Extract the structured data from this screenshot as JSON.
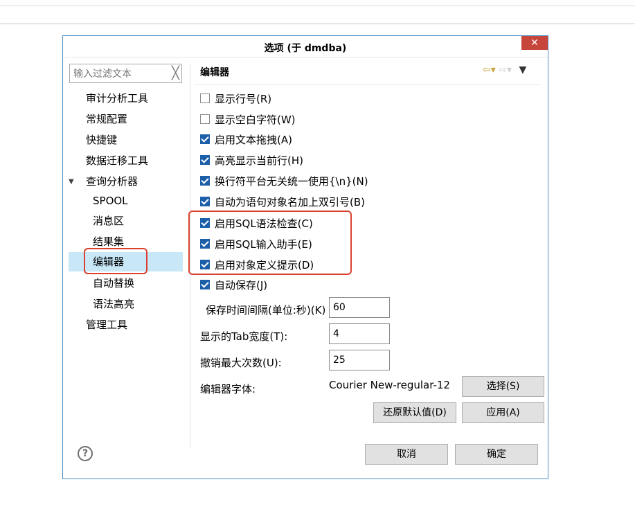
{
  "dialog": {
    "title": "选项   (于 dmdba)",
    "close_icon": "close-icon",
    "close_glyph": "✕"
  },
  "filter": {
    "placeholder": "输入过滤文本",
    "clear_glyph": "╳"
  },
  "tree": {
    "items": [
      {
        "label": "审计分析工具"
      },
      {
        "label": "常规配置"
      },
      {
        "label": "快捷键"
      },
      {
        "label": "数据迁移工具"
      },
      {
        "label": "查询分析器",
        "expanded": true,
        "arrow": "▼"
      },
      {
        "label": "SPOOL"
      },
      {
        "label": "消息区"
      },
      {
        "label": "结果集"
      },
      {
        "label": "编辑器",
        "selected": true
      },
      {
        "label": "自动替换"
      },
      {
        "label": "语法高亮"
      },
      {
        "label": "管理工具"
      }
    ]
  },
  "panel": {
    "title": "编辑器",
    "nav_back": "⇦▾",
    "nav_forward": "⇨▾",
    "nav_menu": "▼",
    "checkboxes": [
      {
        "label": "显示行号(R)",
        "checked": false
      },
      {
        "label": "显示空白字符(W)",
        "checked": false
      },
      {
        "label": "启用文本拖拽(A)",
        "checked": true
      },
      {
        "label": "高亮显示当前行(H)",
        "checked": true
      },
      {
        "label": "换行符平台无关统一使用{\\n}(N)",
        "checked": true
      },
      {
        "label": "自动为语句对象名加上双引号(B)",
        "checked": true
      },
      {
        "label": "启用SQL语法检查(C)",
        "checked": true
      },
      {
        "label": "启用SQL输入助手(E)",
        "checked": true
      },
      {
        "label": "启用对象定义提示(D)",
        "checked": true
      },
      {
        "label": "自动保存(J)",
        "checked": true
      }
    ],
    "autosave_interval_label": "保存时间间隔(单位:秒)(K)",
    "autosave_interval_value": "60",
    "tab_width_label": "显示的Tab宽度(T):",
    "tab_width_value": "4",
    "max_undo_label": "撤销最大次数(U):",
    "max_undo_value": "25",
    "font_label": "编辑器字体:",
    "font_value": "Courier New-regular-12",
    "select_button": "选择(S)",
    "restore_defaults_button": "还原默认值(D)",
    "apply_button": "应用(A)"
  },
  "footer": {
    "help_glyph": "?",
    "cancel_button": "取消",
    "ok_button": "确定"
  },
  "colors": {
    "selection": "#c8e8f8",
    "highlight_box": "#d9412e",
    "close_button": "#c7463c",
    "checkbox_checked": "#1c5fa9",
    "dialog_border": "#4a8ec4"
  }
}
